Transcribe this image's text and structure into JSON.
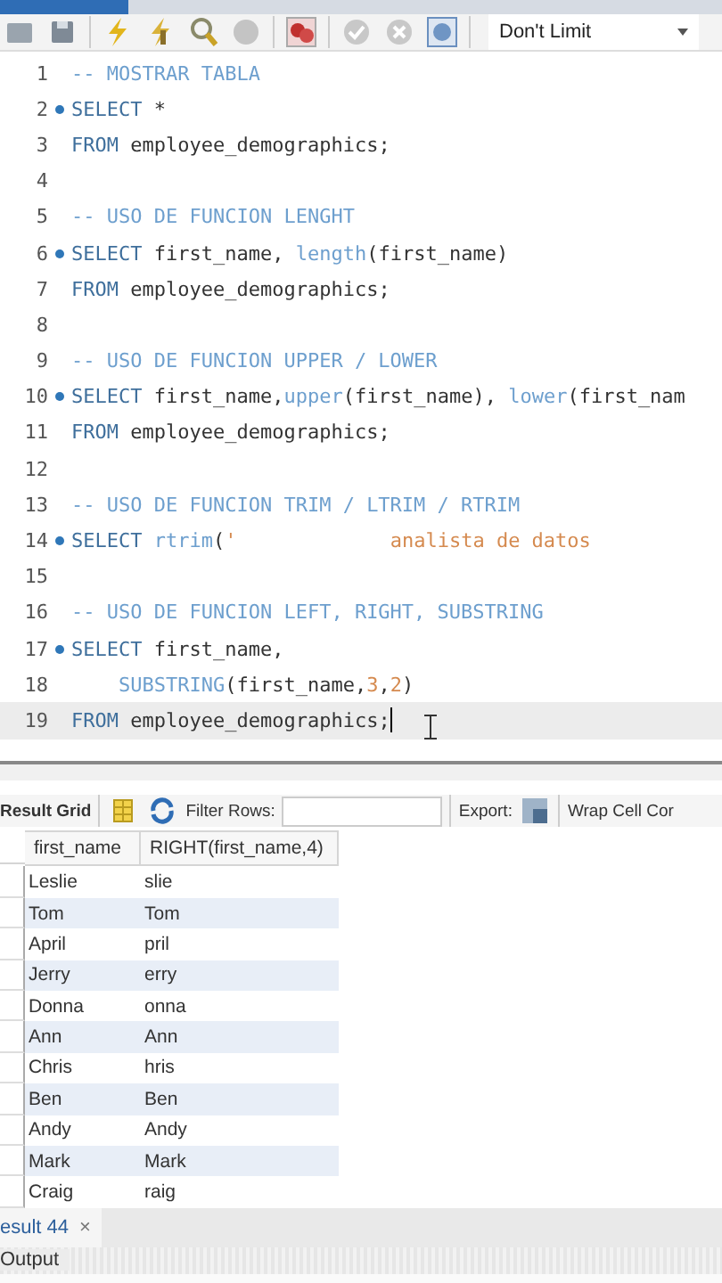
{
  "toolbar": {
    "limit_select": "Don't Limit"
  },
  "editor": {
    "lines": [
      {
        "number": "1",
        "breakpoint": false,
        "current": false,
        "tokens": [
          {
            "kind": "comment",
            "text": "-- MOSTRAR TABLA"
          }
        ]
      },
      {
        "number": "2",
        "breakpoint": true,
        "current": false,
        "tokens": [
          {
            "kind": "keyword",
            "text": "SELECT"
          },
          {
            "kind": "plain",
            "text": " *"
          }
        ]
      },
      {
        "number": "3",
        "breakpoint": false,
        "current": false,
        "tokens": [
          {
            "kind": "keyword",
            "text": "FROM"
          },
          {
            "kind": "plain",
            "text": " employee_demographics;"
          }
        ]
      },
      {
        "number": "4",
        "breakpoint": false,
        "current": false
      },
      {
        "number": "5",
        "breakpoint": false,
        "current": false,
        "tokens": [
          {
            "kind": "comment",
            "text": "-- USO DE FUNCION LENGHT"
          }
        ]
      },
      {
        "number": "6",
        "breakpoint": true,
        "current": false,
        "tokens": [
          {
            "kind": "keyword",
            "text": "SELECT"
          },
          {
            "kind": "plain",
            "text": " first_name, "
          },
          {
            "kind": "function",
            "text": "length"
          },
          {
            "kind": "plain",
            "text": "(first_name)"
          }
        ]
      },
      {
        "number": "7",
        "breakpoint": false,
        "current": false,
        "tokens": [
          {
            "kind": "keyword",
            "text": "FROM"
          },
          {
            "kind": "plain",
            "text": " employee_demographics;"
          }
        ]
      },
      {
        "number": "8",
        "breakpoint": false,
        "current": false
      },
      {
        "number": "9",
        "breakpoint": false,
        "current": false,
        "tokens": [
          {
            "kind": "comment",
            "text": "-- USO DE FUNCION UPPER / LOWER"
          }
        ]
      },
      {
        "number": "10",
        "breakpoint": true,
        "current": false,
        "tokens": [
          {
            "kind": "keyword",
            "text": "SELECT"
          },
          {
            "kind": "plain",
            "text": " first_name,"
          },
          {
            "kind": "function",
            "text": "upper"
          },
          {
            "kind": "plain",
            "text": "(first_name), "
          },
          {
            "kind": "function",
            "text": "lower"
          },
          {
            "kind": "plain",
            "text": "(first_nam"
          }
        ]
      },
      {
        "number": "11",
        "breakpoint": false,
        "current": false,
        "tokens": [
          {
            "kind": "keyword",
            "text": "FROM"
          },
          {
            "kind": "plain",
            "text": " employee_demographics;"
          }
        ]
      },
      {
        "number": "12",
        "breakpoint": false,
        "current": false
      },
      {
        "number": "13",
        "breakpoint": false,
        "current": false,
        "tokens": [
          {
            "kind": "comment",
            "text": "-- USO DE FUNCION TRIM / LTRIM / RTRIM"
          }
        ]
      },
      {
        "number": "14",
        "breakpoint": true,
        "current": false,
        "tokens": [
          {
            "kind": "keyword",
            "text": "SELECT"
          },
          {
            "kind": "function",
            "text": "rtrim",
            "space_before": true
          },
          {
            "kind": "plain",
            "text": "("
          },
          {
            "kind": "string",
            "text": "'             analista de datos"
          }
        ]
      },
      {
        "number": "15",
        "breakpoint": false,
        "current": false
      },
      {
        "number": "16",
        "breakpoint": false,
        "current": false,
        "tokens": [
          {
            "kind": "comment",
            "text": "-- USO DE FUNCION LEFT, RIGHT, SUBSTRING"
          }
        ]
      },
      {
        "number": "17",
        "breakpoint": true,
        "current": false,
        "tokens": [
          {
            "kind": "keyword",
            "text": "SELECT"
          },
          {
            "kind": "plain",
            "text": " first_name,"
          }
        ]
      },
      {
        "number": "18",
        "breakpoint": false,
        "current": false,
        "indented": true,
        "tokens": [
          {
            "kind": "function",
            "text": "SUBSTRING"
          },
          {
            "kind": "plain",
            "text": "(first_name,"
          },
          {
            "kind": "number",
            "text": "3"
          },
          {
            "kind": "plain",
            "text": ","
          },
          {
            "kind": "number",
            "text": "2"
          },
          {
            "kind": "plain",
            "text": ")"
          }
        ]
      },
      {
        "number": "19",
        "breakpoint": false,
        "current": true,
        "tokens": [
          {
            "kind": "keyword",
            "text": "FROM"
          },
          {
            "kind": "plain",
            "text": " employee_demographics;"
          }
        ]
      }
    ]
  },
  "result_toolbar": {
    "title": "Result Grid",
    "filter_label": "Filter Rows:",
    "export_label": "Export:",
    "wrap_label": "Wrap Cell Cor"
  },
  "table": {
    "columns": [
      "first_name",
      "RIGHT(first_name,4)"
    ],
    "rows": [
      [
        "Leslie",
        "slie"
      ],
      [
        "Tom",
        "Tom"
      ],
      [
        "April",
        "pril"
      ],
      [
        "Jerry",
        "erry"
      ],
      [
        "Donna",
        "onna"
      ],
      [
        "Ann",
        "Ann"
      ],
      [
        "Chris",
        "hris"
      ],
      [
        "Ben",
        "Ben"
      ],
      [
        "Andy",
        "Andy"
      ],
      [
        "Mark",
        "Mark"
      ],
      [
        "Craig",
        "raig"
      ]
    ]
  },
  "result_tabs": [
    {
      "label": "esult 44",
      "close": "×"
    }
  ],
  "output_panel": {
    "title": "Output"
  }
}
